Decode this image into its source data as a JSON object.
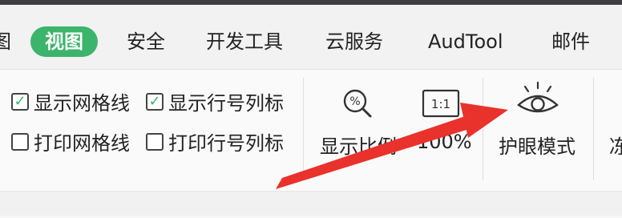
{
  "tabs": {
    "cut": "图",
    "view": "视图",
    "security": "安全",
    "dev_tools": "开发工具",
    "cloud": "云服务",
    "audtool": "AudTool",
    "mail": "邮件"
  },
  "options": {
    "show_gridlines": {
      "label": "显示网格线",
      "checked": true
    },
    "show_headings": {
      "label": "显示行号列标",
      "checked": true
    },
    "print_gridlines": {
      "label": "打印网格线",
      "checked": false
    },
    "print_headings": {
      "label": "打印行号列标",
      "checked": false
    }
  },
  "tools": {
    "zoom_label": "显示比例",
    "zoom_100_label": "100%",
    "zoom_100_icon_text": "1:1",
    "eye_mode_label": "护眼模式",
    "cut_label": "冻"
  },
  "icons": {
    "zoom": "percent-magnifier-icon",
    "ratio": "one-to-one-icon",
    "eye": "eye-icon"
  },
  "colors": {
    "accent": "#3cb46b",
    "arrow": "#e8322b"
  }
}
